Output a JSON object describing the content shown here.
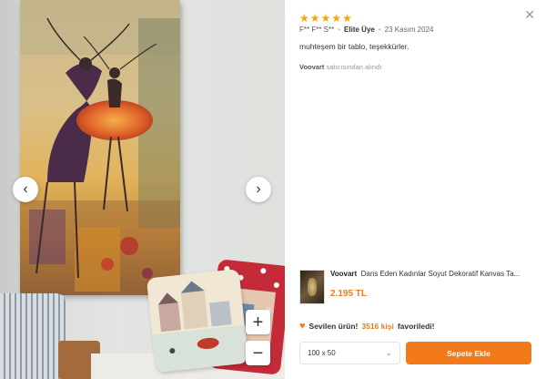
{
  "gallery": {
    "prev_glyph": "‹",
    "next_glyph": "›",
    "zoom_in_glyph": "+",
    "zoom_out_glyph": "−"
  },
  "review": {
    "rating": 5,
    "star_glyph": "★",
    "star_color": "#f7a400",
    "reviewer_name": "F** F** S**",
    "separator": "•",
    "member_badge": "Elite Üye",
    "date": "23 Kasım 2024",
    "comment": "muhteşem bir tablo, teşekkürler.",
    "seller_name": "Voovart",
    "seller_suffix": "satıcısından alındı"
  },
  "close_glyph": "✕",
  "product": {
    "brand": "Voovart",
    "title": "Dans Eden Kadınlar Soyut Dekoratif Kanvas Ta...",
    "price": "2.195 TL"
  },
  "favorite": {
    "heart_glyph": "♥",
    "text_lead": "Sevilen ürün!",
    "count_text": "3516 kişi",
    "text_tail": "favoriledi!"
  },
  "size_select": {
    "value": "100 x 50",
    "chevron": "⌄"
  },
  "cart_button_label": "Sepete Ekle",
  "colors": {
    "accent": "#f27a1a"
  }
}
